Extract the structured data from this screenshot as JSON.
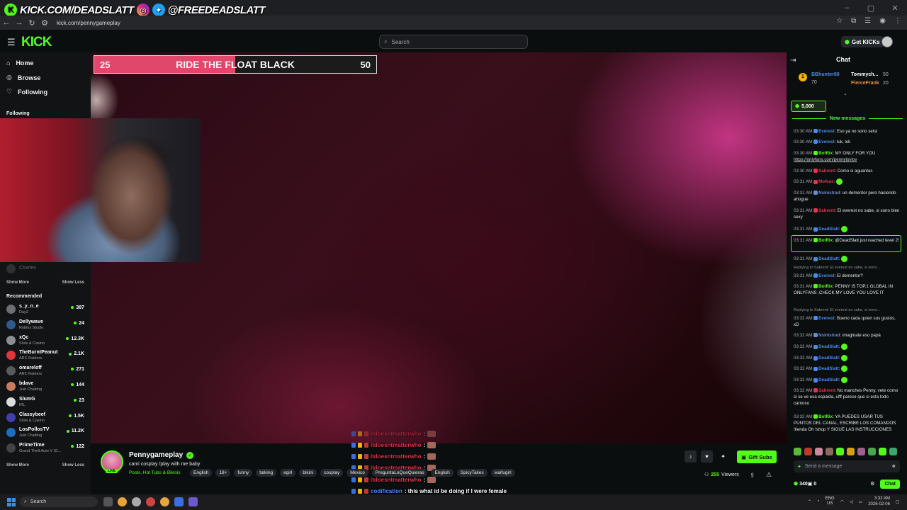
{
  "overlay": {
    "brand_left": "KICK.COM/DEADSLATT",
    "brand_right": "@FREEDEADSLATT"
  },
  "browser": {
    "url": "kick.com/pennygameplay"
  },
  "header": {
    "logo": "KICK",
    "search_placeholder": "Search",
    "get_kicks": "Get KICKs"
  },
  "sidebar": {
    "nav": [
      {
        "label": "Home",
        "icon": "home-icon"
      },
      {
        "label": "Browse",
        "icon": "compass-icon"
      },
      {
        "label": "Following",
        "icon": "heart-icon"
      }
    ],
    "following_label": "Following",
    "following_hidden_item": "Chxrles",
    "show_more": "Show More",
    "show_less": "Show Less",
    "recommended_label": "Recommended",
    "recommended": [
      {
        "name": "s_y_n_e",
        "category": "DayZ",
        "viewers": "387",
        "color": "#6a6f74"
      },
      {
        "name": "Dellywave",
        "category": "Roblox Studio",
        "viewers": "24",
        "color": "#2f5a8a"
      },
      {
        "name": "xQc",
        "category": "Slots & Casino",
        "viewers": "12.3K",
        "color": "#8a8f94"
      },
      {
        "name": "TheBurntPeanut",
        "category": "ARC Raiders",
        "viewers": "2.1K",
        "color": "#e0363a"
      },
      {
        "name": "omareloff",
        "category": "ARC Raiders",
        "viewers": "271",
        "color": "#5a5a5a"
      },
      {
        "name": "bdave",
        "category": "Just Chatting",
        "viewers": "144",
        "color": "#c77c5b"
      },
      {
        "name": "SlumG",
        "category": "IRL",
        "viewers": "23",
        "color": "#dcdcdc"
      },
      {
        "name": "Classybeef",
        "category": "Slots & Casino",
        "viewers": "1.5K",
        "color": "#3f3fb0"
      },
      {
        "name": "LosPollosTV",
        "category": "Just Chatting",
        "viewers": "11.2K",
        "color": "#1d6fbf"
      },
      {
        "name": "PrimeTime",
        "category": "Grand Theft Auto V (G...",
        "viewers": "122",
        "color": "#444"
      }
    ]
  },
  "goal": {
    "current": "25",
    "title": "RIDE THE FLOAT BLACK",
    "target": "50",
    "progress": 0.5
  },
  "chat": {
    "title": "Chat",
    "leaderboard": [
      {
        "name": "BBhunter88",
        "value": "70"
      },
      {
        "name": "Tommych...",
        "value": "50"
      },
      {
        "name": "FierceFrank",
        "value": "20"
      }
    ],
    "pinned_amount": "5,000",
    "new_messages": "New messages",
    "messages": [
      {
        "time": "03:30 AM",
        "user": "Everest",
        "ucolor": "#4a8bf0",
        "text": ": Eso ya no sono setsi"
      },
      {
        "time": "03:30 AM",
        "user": "Everest",
        "ucolor": "#4a8bf0",
        "text": ": luk, luk"
      },
      {
        "time": "03:30 AM",
        "user": "BotRix",
        "ucolor": "#53fc18",
        "text": ": MY ONLY FOR YOU",
        "link": "https://onlyfans.com/pennylovlov"
      },
      {
        "time": "03:30 AM",
        "user": "Sabrent",
        "ucolor": "#e0364f",
        "text": ": Como si aguantas"
      },
      {
        "time": "03:31 AM",
        "user": "Mofeas",
        "ucolor": "#e0364f",
        "text": ":"
      },
      {
        "time": "03:31 AM",
        "user": "Nsinistrad",
        "ucolor": "#6a8ad0",
        "text": ": un dementor pero haciendo ahogue"
      },
      {
        "time": "03:31 AM",
        "user": "Sabrent",
        "ucolor": "#e0364f",
        "text": ": El everest no sabe, si sono bien sexy"
      },
      {
        "time": "03:31 AM",
        "user": "DeadSlatt",
        "ucolor": "#4a8bf0",
        "text": ":"
      },
      {
        "time": "03:31 AM",
        "user": "BotRix",
        "ucolor": "#53fc18",
        "text": ": @DeadSlatt just reached level 2!"
      },
      {
        "time": "03:31 AM",
        "user": "DeadSlatt",
        "ucolor": "#4a8bf0",
        "text": ":"
      },
      {
        "time": "03:31 AM",
        "user": "Everest",
        "ucolor": "#4a8bf0",
        "text": ": El dementor?",
        "reply": "Replying to Sabrent: El everest no sabe, si sono..."
      },
      {
        "time": "03:31 AM",
        "user": "BotRix",
        "ucolor": "#53fc18",
        "text": ": PENNY IS TOP.1 GLOBAL IN ONLYFANS ,CHECK MY LOVE YOU LOVE IT"
      },
      {
        "time": "03:32 AM",
        "user": "Everest",
        "ucolor": "#4a8bf0",
        "text": ": Bueno cada quien sus gustos, xD",
        "reply": "Replying to Sabrent: El everest no sabe, si sono..."
      },
      {
        "time": "03:32 AM",
        "user": "Nsinistrad",
        "ucolor": "#6a8ad0",
        "text": ": imaginate eso papá"
      },
      {
        "time": "03:32 AM",
        "user": "DeadSlatt",
        "ucolor": "#4a8bf0",
        "text": ":"
      },
      {
        "time": "03:32 AM",
        "user": "DeadSlatt",
        "ucolor": "#4a8bf0",
        "text": ":"
      },
      {
        "time": "03:32 AM",
        "user": "DeadSlatt",
        "ucolor": "#4a8bf0",
        "text": ":"
      },
      {
        "time": "03:32 AM",
        "user": "DeadSlatt",
        "ucolor": "#4a8bf0",
        "text": ":"
      },
      {
        "time": "03:32 AM",
        "user": "Sabrent",
        "ucolor": "#e0364f",
        "text": ": No manches Penny, vete como si se ve esa espalda, ufff parece que si esta todo carnoso"
      },
      {
        "time": "03:32 AM",
        "user": "BotRix",
        "ucolor": "#53fc18",
        "text": ": YA PUEDES USAR TUS PUNTOS DEL CANAL, ESCRIBE LOS COMANDOS !tienda Oh !shop Y SIGUE LAS INSTRUCCIONES"
      }
    ],
    "input_placeholder": "Send a message",
    "points": "340",
    "zero": "0",
    "chat_button": "Chat"
  },
  "stream": {
    "streamer": "Pennygameplay",
    "live": "LIVE",
    "title": "cami cosplay /play with me baby",
    "category": "Pools, Hot Tubs & Bikinis",
    "tags": [
      "English",
      "18+",
      "funny",
      "talking",
      "egirl",
      "bikini",
      "cosplay",
      "Mexico",
      "PreguntaLoQueQuieras",
      "English",
      "SpicyTakes",
      "waifugirl"
    ],
    "gift_subs": "Gift Subs",
    "viewers": "255",
    "viewers_label": "Viewers"
  },
  "overlay_chat": [
    {
      "user": "itdoesntmatterwho",
      "color": "red",
      "text": ":"
    },
    {
      "user": "itdoesntmatterwho",
      "color": "red",
      "text": ":"
    },
    {
      "user": "itdoesntmatterwho",
      "color": "red",
      "text": ":"
    },
    {
      "user": "itdoesntmatterwho",
      "color": "red",
      "text": ":"
    },
    {
      "user": "itdoesntmatterwho",
      "color": "red",
      "text": ":"
    },
    {
      "user": "codification",
      "color": "blue",
      "text": ": this what id be doing if I were female"
    },
    {
      "user": "codification",
      "color": "blue",
      "text": ":"
    }
  ],
  "taskbar": {
    "search": "Search",
    "lang1": "ENG",
    "lang2": "US",
    "time": "3:32 AM",
    "date": "2026-02-06"
  }
}
